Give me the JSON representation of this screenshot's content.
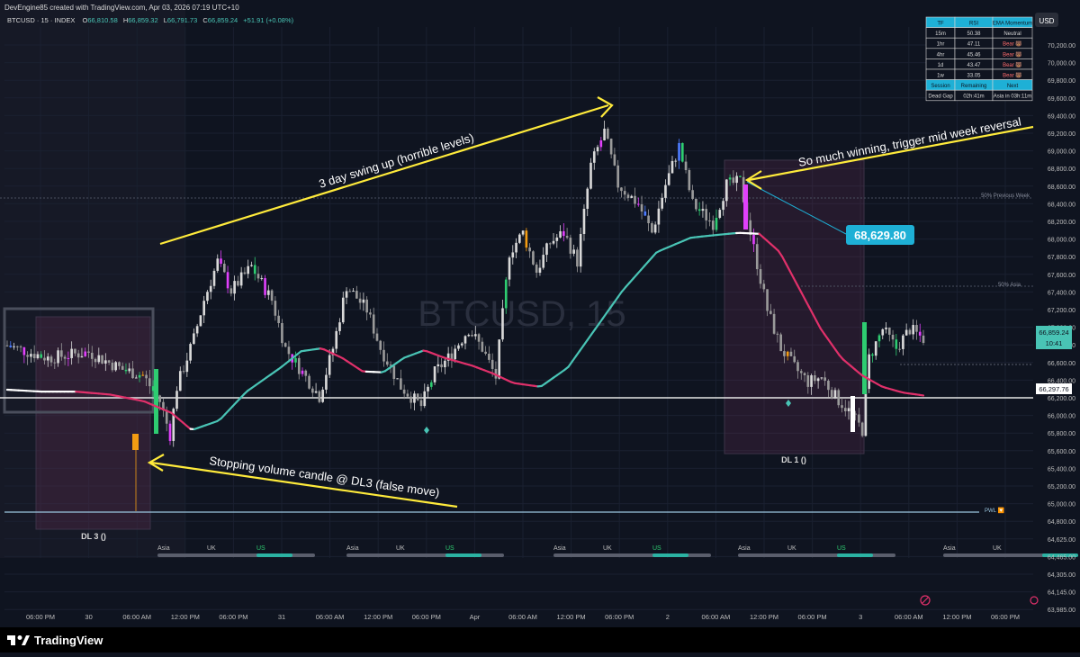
{
  "header": {
    "credit": "DevEngine85 created with TradingView.com, Apr 03, 2026 07:19 UTC+10",
    "symbol": "BTCUSD · 15 · INDEX",
    "o_label": "O",
    "o_val": "66,810.58",
    "h_label": "H",
    "h_val": "66,859.32",
    "l_label": "L",
    "l_val": "66,791.73",
    "c_label": "C",
    "c_val": "66,859.24",
    "change": "+51.91 (+0.08%)"
  },
  "watermark": "BTCUSD, 15",
  "currency_badge": "USD",
  "footer": {
    "brand": "TradingView"
  },
  "colors": {
    "bg": "#0f1420",
    "bull": "#d9d9d9",
    "bear": "#9a9a9a",
    "grid": "#1a2030",
    "ema_up": "#49c4b5",
    "ema_down": "#e0306a",
    "ema_flat": "#ffffff",
    "annotation": "#ffeb3b",
    "label_teal": "#1eb0d6",
    "pink_box": "rgba(120,50,90,0.25)"
  },
  "table": {
    "headers": [
      "TF",
      "RSI",
      "EMA Momentum"
    ],
    "rows": [
      [
        "15m",
        "50.38",
        "Neutral"
      ],
      [
        "1hr",
        "47.11",
        "Bear 🐻"
      ],
      [
        "4hr",
        "45.46",
        "Bear 🐻"
      ],
      [
        "1d",
        "43.47",
        "Bear 🐻"
      ],
      [
        "1w",
        "33.05",
        "Bear 🐻"
      ]
    ],
    "session_headers": [
      "Session",
      "Remaining",
      "Next"
    ],
    "session_row": [
      "Dead Gap",
      "02h:41m",
      "Asia in 03h:11m"
    ]
  },
  "annotations": {
    "swing_up": "3 day swing up (horrible levels)",
    "reversal": "So much winning, trigger mid week reversal",
    "stopping": "Stopping volume candle @ DL3 (false move)",
    "dl3": "DL 3 ()",
    "dl1": "DL 1 ()",
    "prev_week": "50% Previous Week",
    "asia_50": "50% Asia",
    "pwl": "PWL 🔽",
    "price_callout": "68,629.80"
  },
  "price_tags": {
    "current": "66,859.24",
    "countdown": "10:41",
    "level": "66,297.76"
  },
  "sessions": [
    {
      "labels": [
        "Asia",
        "UK",
        "US"
      ]
    },
    {
      "labels": [
        "Asia",
        "UK",
        "US"
      ]
    },
    {
      "labels": [
        "Asia",
        "UK",
        "US"
      ]
    },
    {
      "labels": [
        "Asia",
        "UK",
        "US"
      ]
    },
    {
      "labels": [
        "Asia",
        "UK"
      ]
    }
  ],
  "chart_data": {
    "type": "candlestick",
    "title": "",
    "xlabel": "",
    "ylabel": "",
    "ylim": [
      63985,
      70345
    ],
    "x_ticks": [
      "06:00 PM",
      "30",
      "06:00 AM",
      "12:00 PM",
      "06:00 PM",
      "31",
      "06:00 AM",
      "12:00 PM",
      "06:00 PM",
      "Apr",
      "06:00 AM",
      "12:00 PM",
      "06:00 PM",
      "2",
      "06:00 AM",
      "12:00 PM",
      "06:00 PM",
      "3",
      "06:00 AM",
      "12:00 PM",
      "06:00 PM"
    ],
    "y_ticks": [
      "70,200.00",
      "70,000.00",
      "69,800.00",
      "69,600.00",
      "69,400.00",
      "69,200.00",
      "69,000.00",
      "68,800.00",
      "68,600.00",
      "68,400.00",
      "68,200.00",
      "68,000.00",
      "67,800.00",
      "67,600.00",
      "67,400.00",
      "67,200.00",
      "67,000.00",
      "66,800.00",
      "66,600.00",
      "66,400.00",
      "66,200.00",
      "66,000.00",
      "65,800.00",
      "65,600.00",
      "65,400.00",
      "65,200.00",
      "65,000.00",
      "64,800.00",
      "64,625.00",
      "64,465.00",
      "64,305.00",
      "64,145.00",
      "63,985.00"
    ],
    "grid": true,
    "legend": "top-right table",
    "close_path": [
      [
        0,
        66830
      ],
      [
        12,
        66700
      ],
      [
        24,
        66760
      ],
      [
        34,
        66580
      ],
      [
        40,
        66520
      ],
      [
        45,
        66250
      ],
      [
        48,
        65900
      ],
      [
        50,
        66400
      ],
      [
        55,
        66900
      ],
      [
        58,
        67300
      ],
      [
        62,
        67700
      ],
      [
        66,
        67400
      ],
      [
        72,
        67650
      ],
      [
        78,
        67300
      ],
      [
        82,
        66800
      ],
      [
        88,
        66500
      ],
      [
        92,
        66300
      ],
      [
        96,
        66800
      ],
      [
        100,
        67450
      ],
      [
        106,
        67200
      ],
      [
        110,
        66800
      ],
      [
        116,
        66400
      ],
      [
        122,
        66200
      ],
      [
        126,
        66550
      ],
      [
        130,
        66700
      ],
      [
        136,
        67000
      ],
      [
        140,
        66800
      ],
      [
        144,
        66500
      ],
      [
        148,
        67800
      ],
      [
        152,
        68000
      ],
      [
        156,
        67600
      ],
      [
        160,
        67900
      ],
      [
        164,
        68000
      ],
      [
        168,
        67700
      ],
      [
        172,
        68700
      ],
      [
        176,
        69050
      ],
      [
        180,
        68500
      ],
      [
        186,
        68300
      ],
      [
        190,
        68000
      ],
      [
        194,
        68500
      ],
      [
        198,
        68900
      ],
      [
        202,
        68300
      ],
      [
        208,
        68100
      ],
      [
        212,
        68500
      ],
      [
        216,
        68530
      ],
      [
        219,
        68000
      ],
      [
        224,
        67200
      ],
      [
        228,
        66800
      ],
      [
        232,
        66600
      ],
      [
        236,
        66450
      ],
      [
        240,
        66500
      ],
      [
        244,
        66300
      ],
      [
        248,
        66150
      ],
      [
        252,
        65950
      ],
      [
        254,
        66700
      ],
      [
        258,
        67000
      ],
      [
        262,
        66800
      ],
      [
        266,
        67000
      ],
      [
        270,
        66900
      ]
    ],
    "ema_path": [
      [
        0,
        66370
      ],
      [
        10,
        66350
      ],
      [
        20,
        66350
      ],
      [
        30,
        66320
      ],
      [
        40,
        66250
      ],
      [
        48,
        66130
      ],
      [
        54,
        65950
      ],
      [
        62,
        66050
      ],
      [
        70,
        66350
      ],
      [
        80,
        66600
      ],
      [
        86,
        66770
      ],
      [
        92,
        66800
      ],
      [
        98,
        66700
      ],
      [
        104,
        66560
      ],
      [
        110,
        66550
      ],
      [
        116,
        66700
      ],
      [
        122,
        66780
      ],
      [
        128,
        66700
      ],
      [
        136,
        66620
      ],
      [
        142,
        66540
      ],
      [
        148,
        66440
      ],
      [
        156,
        66400
      ],
      [
        164,
        66600
      ],
      [
        172,
        67000
      ],
      [
        180,
        67400
      ],
      [
        190,
        67800
      ],
      [
        200,
        67950
      ],
      [
        208,
        67980
      ],
      [
        214,
        68000
      ],
      [
        220,
        67990
      ],
      [
        226,
        67800
      ],
      [
        232,
        67400
      ],
      [
        238,
        67000
      ],
      [
        244,
        66700
      ],
      [
        250,
        66520
      ],
      [
        256,
        66400
      ],
      [
        262,
        66340
      ],
      [
        268,
        66310
      ]
    ]
  }
}
